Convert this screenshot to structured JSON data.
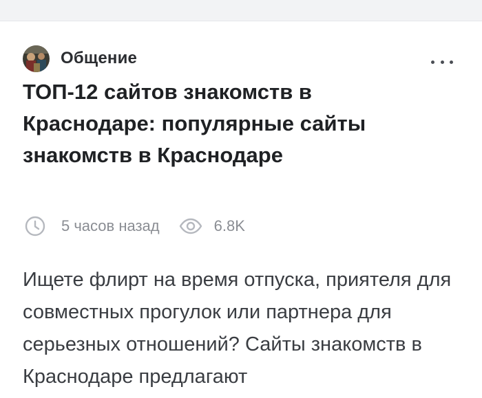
{
  "post": {
    "community": {
      "name": "Общение",
      "avatar_icon": "community-avatar"
    },
    "more_icon": "more-horizontal-icon",
    "title": "ТОП-12 сайтов знакомств в Краснодаре: популярные сайты знакомств в Краснодаре",
    "meta": {
      "time_icon": "clock-icon",
      "time": "5 часов назад",
      "views_icon": "eye-icon",
      "views": "6.8K"
    },
    "body": "Ищете флирт на время отпуска, приятеля для совместных прогулок или партнера для серьезных отношений? Сайты знакомств в Краснодаре предлагают"
  },
  "colors": {
    "page_background": "#f2f3f5",
    "card_background": "#ffffff",
    "title_text": "#1f2124",
    "body_text": "#3a3d42",
    "meta_text": "#8a8d93"
  }
}
